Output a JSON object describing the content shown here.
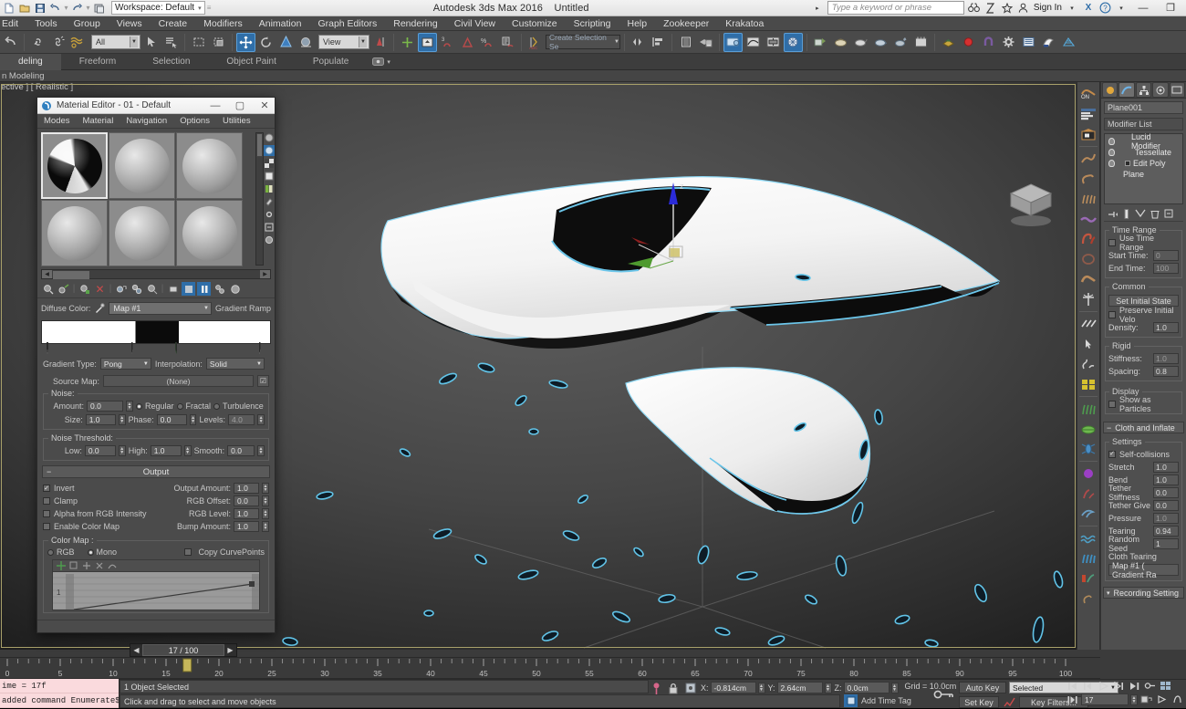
{
  "titlebar": {
    "quick_access": [
      "new-icon",
      "open-icon",
      "save-icon",
      "undo-icon",
      "redo-icon",
      "project-icon"
    ],
    "workspace_label": "Workspace: Default",
    "app_title": "Autodesk 3ds Max 2016",
    "document_title": "Untitled",
    "search_placeholder": "Type a keyword or phrase",
    "signin_label": "Sign In",
    "right_icons": [
      "binoculars-icon",
      "communication-icon",
      "star-icon",
      "user-icon"
    ],
    "window_buttons": [
      "minimize-icon",
      "restore-icon"
    ]
  },
  "menubar": {
    "items": [
      "Edit",
      "Tools",
      "Group",
      "Views",
      "Create",
      "Modifiers",
      "Animation",
      "Graph Editors",
      "Rendering",
      "Civil View",
      "Customize",
      "Scripting",
      "Help",
      "Zookeeper",
      "Krakatoa"
    ]
  },
  "toolbar": {
    "selection_filter": "All",
    "reference_coord": "View",
    "named_selection_set": "Create Selection Se",
    "icons": [
      "undo-icon",
      "redo-icon",
      "select-link-icon",
      "unlink-icon",
      "bind-space-warp-icon",
      "select-object-icon",
      "select-by-name-icon",
      "rectangular-region-icon",
      "window-crossing-icon",
      "select-and-move-icon",
      "select-and-rotate-icon",
      "select-and-scale-icon",
      "placement-icon",
      "use-center-icon",
      "mirror-icon",
      "align-icon",
      "snap-toggle-icon",
      "angle-snap-icon",
      "percent-snap-icon",
      "spinner-snap-icon",
      "edit-named-selection-icon",
      "mirror-flip-icon",
      "align-tools-icon",
      "layer-manager-icon",
      "graphite-icon",
      "curve-editor-icon",
      "schematic-view-icon",
      "material-editor-icon",
      "render-setup-icon",
      "render-frame-icon",
      "render-production-icon",
      "render-iterative-icon",
      "activeshade-icon",
      "scene-converter-icon",
      "project-folder-icon",
      "preferences-icon",
      "container-icon",
      "quicksilver-icon",
      "mesh-icon"
    ]
  },
  "ribbon": {
    "tabs": [
      "deling",
      "Freeform",
      "Selection",
      "Object Paint",
      "Populate"
    ],
    "active_tab": "deling",
    "subtitle": "n Modeling"
  },
  "viewport": {
    "label": "ective ] [ Realistic ]",
    "gizmo_axis_labels": [
      "z"
    ],
    "view_cube": "view-cube-icon"
  },
  "material_editor": {
    "title": "Material Editor - 01 - Default",
    "window_buttons": [
      "minimize-icon",
      "maximize-icon",
      "close-icon"
    ],
    "menu": [
      "Modes",
      "Material",
      "Navigation",
      "Options",
      "Utilities"
    ],
    "slots": [
      {
        "name": "slot-1",
        "type": "gradient-ramp",
        "selected": true
      },
      {
        "name": "slot-2",
        "type": "default",
        "selected": false
      },
      {
        "name": "slot-3",
        "type": "default",
        "selected": false
      },
      {
        "name": "slot-4",
        "type": "default",
        "selected": false
      },
      {
        "name": "slot-5",
        "type": "default",
        "selected": false
      },
      {
        "name": "slot-6",
        "type": "default",
        "selected": false
      }
    ],
    "toolbar_icons": [
      "get-material-icon",
      "assign-material-icon",
      "reset-map-icon",
      "delete-icon",
      "put-to-library-icon",
      "material-id-channel-icon",
      "show-in-viewport-icon",
      "show-end-result-icon",
      "go-to-parent-icon",
      "go-forward-sibling-icon",
      "sample-type-icon",
      "backlight-icon"
    ],
    "diffuse_label": "Diffuse Color:",
    "map_name": "Map #1",
    "map_type": "Gradient Ramp",
    "gradient": {
      "flags": [
        {
          "position_pct": 2,
          "color": "#d4d4d4"
        },
        {
          "position_pct": 41,
          "color": "#a8a8a8"
        },
        {
          "position_pct": 60,
          "color": "#2aa32a"
        },
        {
          "position_pct": 96,
          "color": "#d4d4d4"
        }
      ],
      "stops": [
        {
          "position_pct": 0,
          "color": "#ffffff"
        },
        {
          "position_pct": 41,
          "color": "#0b0b0b"
        },
        {
          "position_pct": 60,
          "color": "#ffffff"
        }
      ]
    },
    "gradient_type_label": "Gradient Type:",
    "gradient_type_value": "Pong",
    "interpolation_label": "Interpolation:",
    "interpolation_value": "Solid",
    "source_map_label": "Source Map:",
    "source_map_value": "(None)",
    "noise": {
      "group_label": "Noise:",
      "amount_label": "Amount:",
      "amount_value": "0.0",
      "types": [
        "Regular",
        "Fractal",
        "Turbulence"
      ],
      "selected_type": "Regular",
      "size_label": "Size:",
      "size_value": "1.0",
      "phase_label": "Phase:",
      "phase_value": "0.0",
      "levels_label": "Levels:",
      "levels_value": "4.0"
    },
    "noise_threshold": {
      "group_label": "Noise Threshold:",
      "low_label": "Low:",
      "low_value": "0.0",
      "high_label": "High:",
      "high_value": "1.0",
      "smooth_label": "Smooth:",
      "smooth_value": "0.0"
    },
    "output": {
      "title": "Output",
      "invert_label": "Invert",
      "invert_checked": true,
      "clamp_label": "Clamp",
      "clamp_checked": false,
      "alpha_label": "Alpha from RGB Intensity",
      "alpha_checked": false,
      "enable_colormap_label": "Enable Color Map",
      "enable_colormap_checked": false,
      "output_amount_label": "Output Amount:",
      "output_amount_value": "1.0",
      "rgb_offset_label": "RGB Offset:",
      "rgb_offset_value": "0.0",
      "rgb_level_label": "RGB Level:",
      "rgb_level_value": "1.0",
      "bump_amount_label": "Bump Amount:",
      "bump_amount_value": "1.0"
    },
    "color_map": {
      "group_label": "Color Map :",
      "rgb_label": "RGB",
      "mono_label": "Mono",
      "selected_mode": "Mono",
      "copy_curvepoints_label": "Copy CurvePoints",
      "copy_curvepoints_checked": false,
      "axis_label": "1"
    }
  },
  "command_panel": {
    "tabs": [
      "create-tab-icon",
      "modify-tab-icon",
      "hierarchy-tab-icon",
      "motion-tab-icon",
      "display-tab-icon",
      "utilities-tab-icon"
    ],
    "active_tab_index": 1,
    "object_name": "Plane001",
    "modifier_list_label": "Modifier List",
    "modifier_stack": [
      {
        "label": "Lucid Modifier",
        "indent": 1
      },
      {
        "label": "Tessellate",
        "indent": 2
      },
      {
        "label": "Edit Poly",
        "indent": 2,
        "has_subobject": true
      },
      {
        "label": "Plane",
        "indent": 0
      }
    ],
    "stack_buttons": [
      "pin-stack-icon",
      "show-end-result-icon",
      "make-unique-icon",
      "remove-modifier-icon",
      "configure-sets-icon"
    ],
    "time_range": {
      "group_label": "Time Range",
      "use_time_range_label": "Use Time Range",
      "use_time_range_checked": false,
      "start_time_label": "Start Time:",
      "start_time_value": "0",
      "end_time_label": "End Time:",
      "end_time_value": "100"
    },
    "common": {
      "group_label": "Common",
      "set_initial_state_label": "Set Initial State",
      "preserve_velocity_label": "Preserve Initial Velo",
      "preserve_velocity_checked": false,
      "density_label": "Density:",
      "density_value": "1.0"
    },
    "rigid": {
      "group_label": "Rigid",
      "stiffness_label": "Stiffness:",
      "stiffness_value": "1.0",
      "spacing_label": "Spacing:",
      "spacing_value": "0.8"
    },
    "display": {
      "group_label": "Display",
      "show_as_particles_label": "Show as Particles",
      "show_as_particles_checked": false
    },
    "cloth": {
      "rollout_title": "Cloth and Inflate",
      "settings_label": "Settings",
      "self_collisions_label": "Self-collisions",
      "self_collisions_checked": true,
      "stretch_label": "Stretch",
      "stretch_value": "1.0",
      "bend_label": "Bend",
      "bend_value": "1.0",
      "tether_stiffness_label": "Tether Stiffness",
      "tether_stiffness_value": "0.0",
      "tether_give_label": "Tether Give",
      "tether_give_value": "0.0",
      "pressure_label": "Pressure",
      "pressure_value": "1.0",
      "tearing_label": "Tearing",
      "tearing_value": "0.94",
      "random_seed_label": "Random Seed",
      "random_seed_value": "1",
      "cloth_tearing_label": "Cloth Tearing",
      "cloth_tearing_map": "Map #1  ( Gradient Ra",
      "recording_settings_label": "Recording Setting"
    }
  },
  "timeline": {
    "current_frame_display": "17 / 100",
    "prev_frame_icon": "chevron-left-icon",
    "next_frame_icon": "chevron-right-icon",
    "slider_frame": 17,
    "range_start": 0,
    "range_end": 100,
    "tick_labels": [
      "0",
      "5",
      "10",
      "15",
      "20",
      "25",
      "30",
      "35",
      "40",
      "45",
      "50",
      "55",
      "60",
      "65",
      "70",
      "75",
      "80",
      "85",
      "90",
      "95",
      "100"
    ]
  },
  "listener": {
    "line1": "ime = 17f",
    "line2": "added command Enumerate$"
  },
  "status": {
    "selection_status": "1 Object Selected",
    "prompt": "Click and drag to select and move objects",
    "lock_icon": "lock-selection-icon",
    "pin_icon": "pin-stack-icon",
    "absolute_mode_icon": "absolute-mode-icon",
    "x_label": "X:",
    "x_value": "-0.814cm",
    "y_label": "Y:",
    "y_value": "2.64cm",
    "z_label": "Z:",
    "z_value": "0.0cm",
    "grid_label": "Grid = 10.0cm",
    "add_time_tag_label": "Add Time Tag",
    "key_mode_icon": "key-mode-icon",
    "auto_key_label": "Auto Key",
    "set_key_label": "Set Key",
    "key_filters_label": "Key Filters...",
    "selected_dropdown": "Selected",
    "current_frame_field": "17",
    "playback_icons": [
      "go-to-start-icon",
      "previous-frame-icon",
      "play-icon",
      "next-frame-icon",
      "go-to-end-icon",
      "key-mode-toggle-icon",
      "time-configuration-icon"
    ],
    "nav_icons": [
      "zoom-icon",
      "zoom-all-icon",
      "zoom-extents-icon",
      "field-of-view-icon",
      "pan-icon",
      "orbit-icon",
      "maximize-viewport-icon"
    ]
  },
  "colors": {
    "accent_blue": "#2f6ea8",
    "panel_bg": "#4a4a4a",
    "viewport_bg": "#4a4a4a",
    "selection_cyan": "#5ec8f0",
    "listener_pink": "#fadadd",
    "timeline_slider": "#c6b75b",
    "viewport_border": "#a8a06a"
  }
}
